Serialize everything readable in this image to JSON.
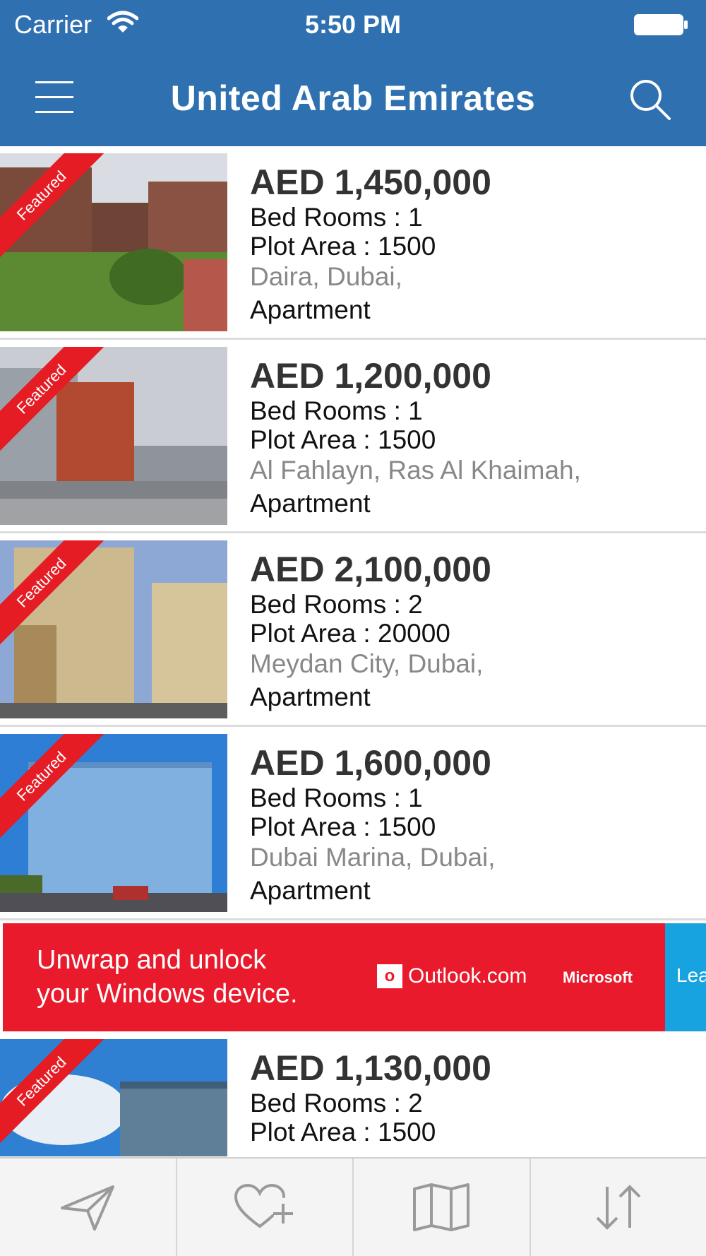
{
  "status": {
    "carrier": "Carrier",
    "time": "5:50 PM"
  },
  "header": {
    "title": "United Arab Emirates"
  },
  "listings": [
    {
      "price": "AED 1,450,000",
      "bedrooms": "Bed Rooms : 1",
      "plot_area": "Plot Area : 1500",
      "location": "Daira, Dubai,",
      "type": "Apartment",
      "badge": "Featured"
    },
    {
      "price": "AED 1,200,000",
      "bedrooms": "Bed Rooms : 1",
      "plot_area": "Plot Area : 1500",
      "location": "Al Fahlayn, Ras Al Khaimah,",
      "type": "Apartment",
      "badge": "Featured"
    },
    {
      "price": "AED 2,100,000",
      "bedrooms": "Bed Rooms : 2",
      "plot_area": "Plot Area : 20000",
      "location": "Meydan City, Dubai,",
      "type": "Apartment",
      "badge": "Featured"
    },
    {
      "price": "AED 1,600,000",
      "bedrooms": "Bed Rooms : 1",
      "plot_area": "Plot Area : 1500",
      "location": "Dubai Marina, Dubai,",
      "type": "Apartment",
      "badge": "Featured"
    },
    {
      "price": "AED 1,130,000",
      "bedrooms": "Bed Rooms : 2",
      "plot_area": "Plot Area : 1500",
      "badge": "Featured"
    }
  ],
  "ad": {
    "headline_line1": "Unwrap and unlock",
    "headline_line2": "your Windows device.",
    "brand": "Outlook.com",
    "company": "Microsoft",
    "cta": "Lear"
  },
  "tabs": [
    {
      "icon": "send-icon"
    },
    {
      "icon": "add-favorite-icon"
    },
    {
      "icon": "map-icon"
    },
    {
      "icon": "sort-icon"
    }
  ],
  "colors": {
    "header": "#2f70b0",
    "badge": "#e51c24",
    "ad": "#e81a2b",
    "ad_cta": "#16a3e0"
  }
}
